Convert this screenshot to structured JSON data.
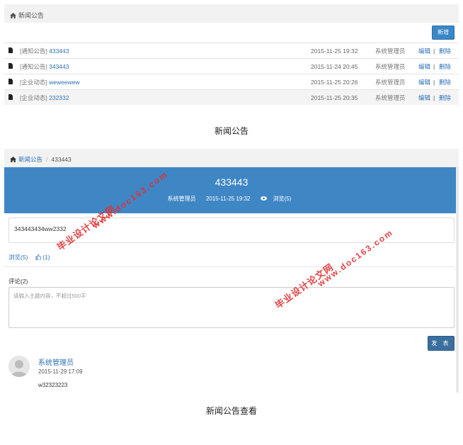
{
  "list_panel": {
    "breadcrumb": "新闻公告",
    "add_button": "新增",
    "rows": [
      {
        "category": "[通知公告]",
        "title": "433443",
        "date": "2015-11-25 19:32",
        "author": "系统管理员",
        "edit": "编辑",
        "sep": "|",
        "del": "删除"
      },
      {
        "category": "[通知公告]",
        "title": "343443",
        "date": "2015-11-24 20:45",
        "author": "系统管理员",
        "edit": "编辑",
        "sep": "|",
        "del": "删除"
      },
      {
        "category": "[企业动态]",
        "title": "weweewew",
        "date": "2015-11-25 20:26",
        "author": "系统管理员",
        "edit": "编辑",
        "sep": "|",
        "del": "删除"
      },
      {
        "category": "[企业动态]",
        "title": "232332",
        "date": "2015-11-25 20:35",
        "author": "系统管理员",
        "edit": "编辑",
        "sep": "|",
        "del": "删除"
      }
    ]
  },
  "caption1": "新闻公告",
  "detail_panel": {
    "breadcrumb_parent": "新闻公告",
    "breadcrumb_sep": "/",
    "breadcrumb_current": "433443",
    "title": "433443",
    "author": "系统管理员",
    "date": "2015-11-25 19:32",
    "views_meta": "浏览(5)",
    "content": "343443434ww2332",
    "views": "浏览(5)",
    "likes": "(1)",
    "comments_label": "评论(2)",
    "comment_placeholder": "请输入主题内容，不超过500字",
    "post_button": "发 表",
    "comment": {
      "user": "系统管理员",
      "time": "2015-11-29 17:09",
      "text": "w32323223"
    }
  },
  "caption2": "新闻公告查看",
  "watermark": {
    "line1": "毕业设计论文网",
    "line2": "www.doc163.com"
  },
  "colors": {
    "accent": "#3f86c5",
    "link": "#2e72b8",
    "watermark": "#e23030"
  }
}
